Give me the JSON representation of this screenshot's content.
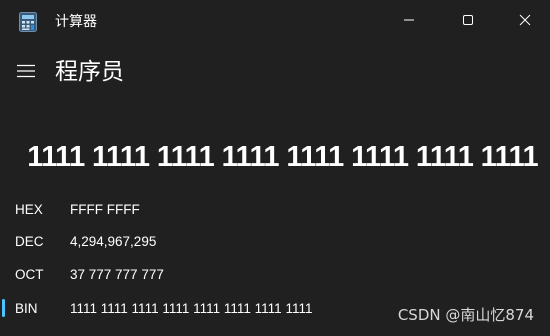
{
  "window": {
    "title": "计算器",
    "app_icon": "calculator-icon",
    "controls": {
      "minimize_icon": "minimize-icon",
      "maximize_icon": "maximize-icon",
      "close_icon": "close-icon"
    }
  },
  "header": {
    "menu_icon": "hamburger-menu-icon",
    "mode": "程序员"
  },
  "display": {
    "value": "1111 1111 1111 1111 1111 1111 1111 1111"
  },
  "bases": [
    {
      "label": "HEX",
      "value": "FFFF FFFF",
      "selected": false
    },
    {
      "label": "DEC",
      "value": "4,294,967,295",
      "selected": false
    },
    {
      "label": "OCT",
      "value": "37 777 777 777",
      "selected": false
    },
    {
      "label": "BIN",
      "value": "1111 1111 1111 1111 1111 1111 1111 1111",
      "selected": true
    }
  ],
  "watermark": "CSDN @南山忆874",
  "colors": {
    "background": "#202020",
    "accent": "#4cc2ff",
    "text": "#ffffff"
  }
}
